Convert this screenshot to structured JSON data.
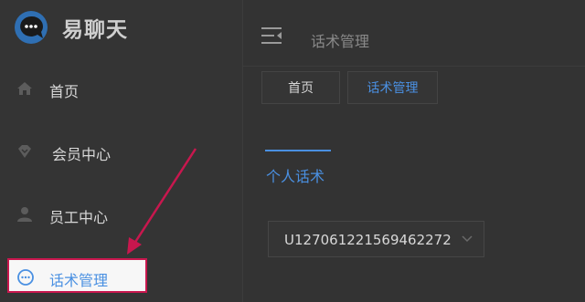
{
  "app": {
    "name": "易聊天",
    "logo_icon": "chat-bubble-logo"
  },
  "sidebar": {
    "items": [
      {
        "label": "首页",
        "icon": "home-icon"
      },
      {
        "label": "会员中心",
        "icon": "diamond-icon"
      },
      {
        "label": "员工中心",
        "icon": "user-icon"
      },
      {
        "label": "话术管理",
        "icon": "chat-dots-icon",
        "active": true
      }
    ]
  },
  "header": {
    "title": "话术管理",
    "menu_icon": "menu-fold-icon"
  },
  "tabs": [
    {
      "label": "首页"
    },
    {
      "label": "话术管理",
      "active": true
    }
  ],
  "subtabs": [
    {
      "label": "个人话术",
      "active": true
    }
  ],
  "select": {
    "value": "U127061221569462272"
  },
  "colors": {
    "accent": "#4a90e2",
    "highlight_border": "#c8174e",
    "background": "#333333"
  }
}
